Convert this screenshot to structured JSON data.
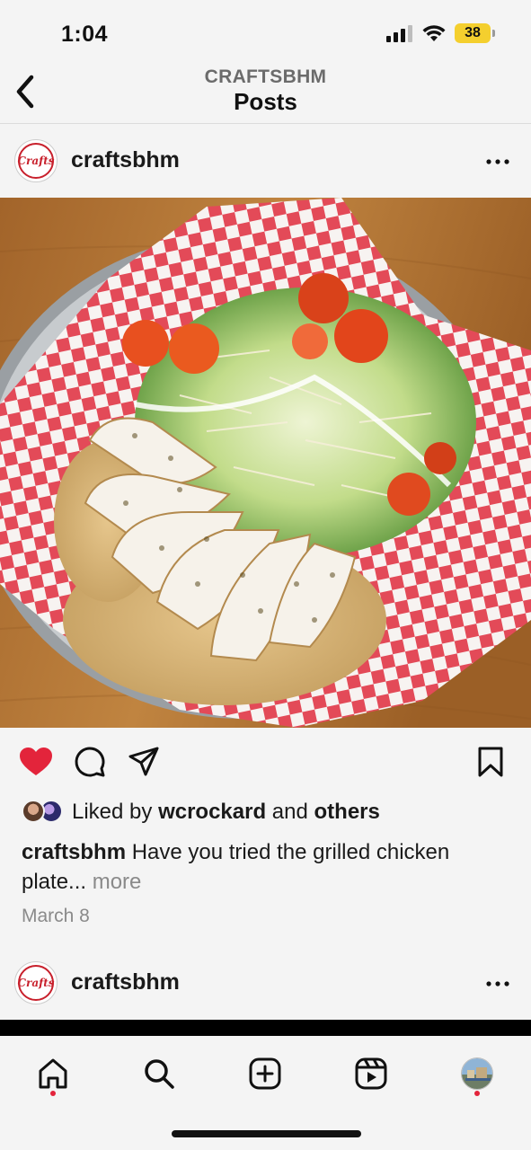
{
  "status": {
    "time": "1:04",
    "battery": "38"
  },
  "header": {
    "account": "CRAFTSBHM",
    "title": "Posts"
  },
  "post": {
    "username": "craftsbhm",
    "logo_text": "Crafts",
    "liked": true,
    "likes": {
      "prefix": "Liked by",
      "user": "wcrockard",
      "conj": "and",
      "others": "others"
    },
    "caption": {
      "user": "craftsbhm",
      "text": "Have you tried the grilled chicken plate...",
      "more": "more"
    },
    "date": "March 8"
  },
  "next_post": {
    "username": "craftsbhm"
  },
  "colors": {
    "like_red": "#e3243b",
    "logo_red": "#c8202c",
    "battery_yellow": "#f4cf2e"
  },
  "icons": {
    "back": "chevron-left-icon",
    "more": "more-horizontal-icon",
    "like": "heart-icon",
    "comment": "comment-icon",
    "share": "send-icon",
    "save": "bookmark-icon",
    "home": "home-icon",
    "search": "search-icon",
    "create": "add-post-icon",
    "reels": "reels-icon"
  },
  "tab_bar": {
    "items": [
      "home",
      "search",
      "create",
      "reels",
      "profile"
    ],
    "notification_dots": [
      "home",
      "profile"
    ]
  }
}
